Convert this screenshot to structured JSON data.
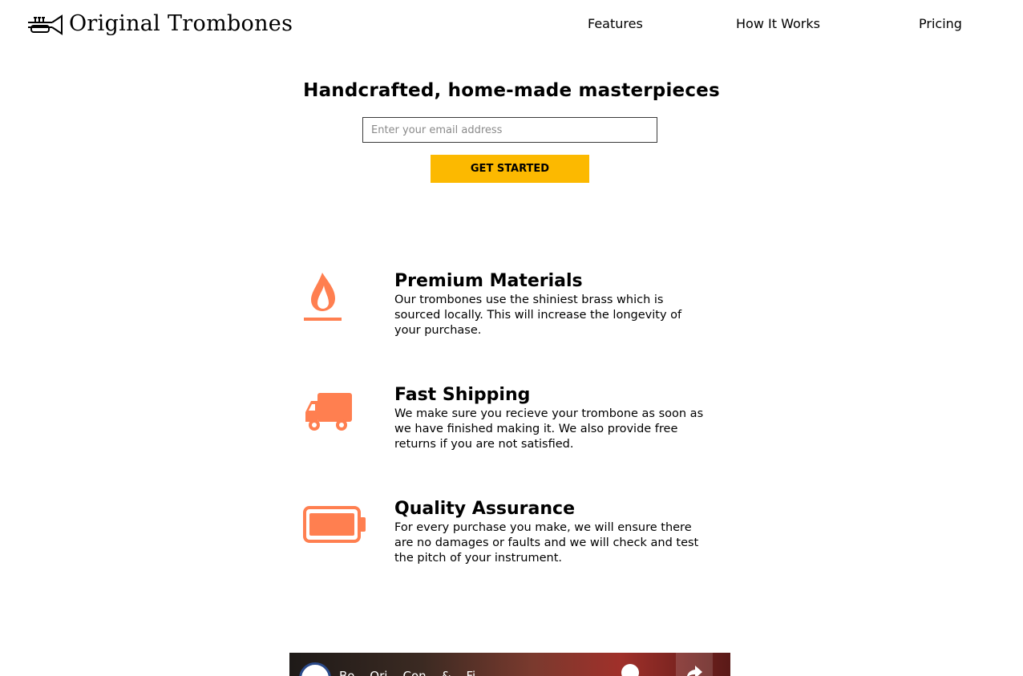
{
  "header": {
    "brand": "Original Trombones",
    "logo_icon": "trumpet-icon",
    "nav": [
      {
        "label": "Features"
      },
      {
        "label": "How It Works"
      },
      {
        "label": "Pricing"
      }
    ]
  },
  "hero": {
    "title": "Handcrafted, home-made masterpieces",
    "email_placeholder": "Enter your email address",
    "cta_label": "GET STARTED"
  },
  "features": [
    {
      "icon": "fire-icon",
      "title": "Premium Materials",
      "description": "Our trombones use the shiniest brass which is sourced locally. This will increase the longevity of your purchase."
    },
    {
      "icon": "truck-icon",
      "title": "Fast Shipping",
      "description": "We make sure you recieve your trombone as soon as we have finished making it. We also provide free returns if you are not satisfied."
    },
    {
      "icon": "battery-full-icon",
      "title": "Quality Assurance",
      "description": "For every purchase you make, we will ensure there are no damages or faults and we will check and test the pitch of your instrument."
    }
  ],
  "video": {
    "title": "Bo... Ori... Con... & ...Fi...",
    "icons": [
      "channel-avatar",
      "watch-later-icon",
      "share-icon"
    ]
  },
  "colors": {
    "accent": "#fcb900",
    "icon": "#ff7f50"
  }
}
